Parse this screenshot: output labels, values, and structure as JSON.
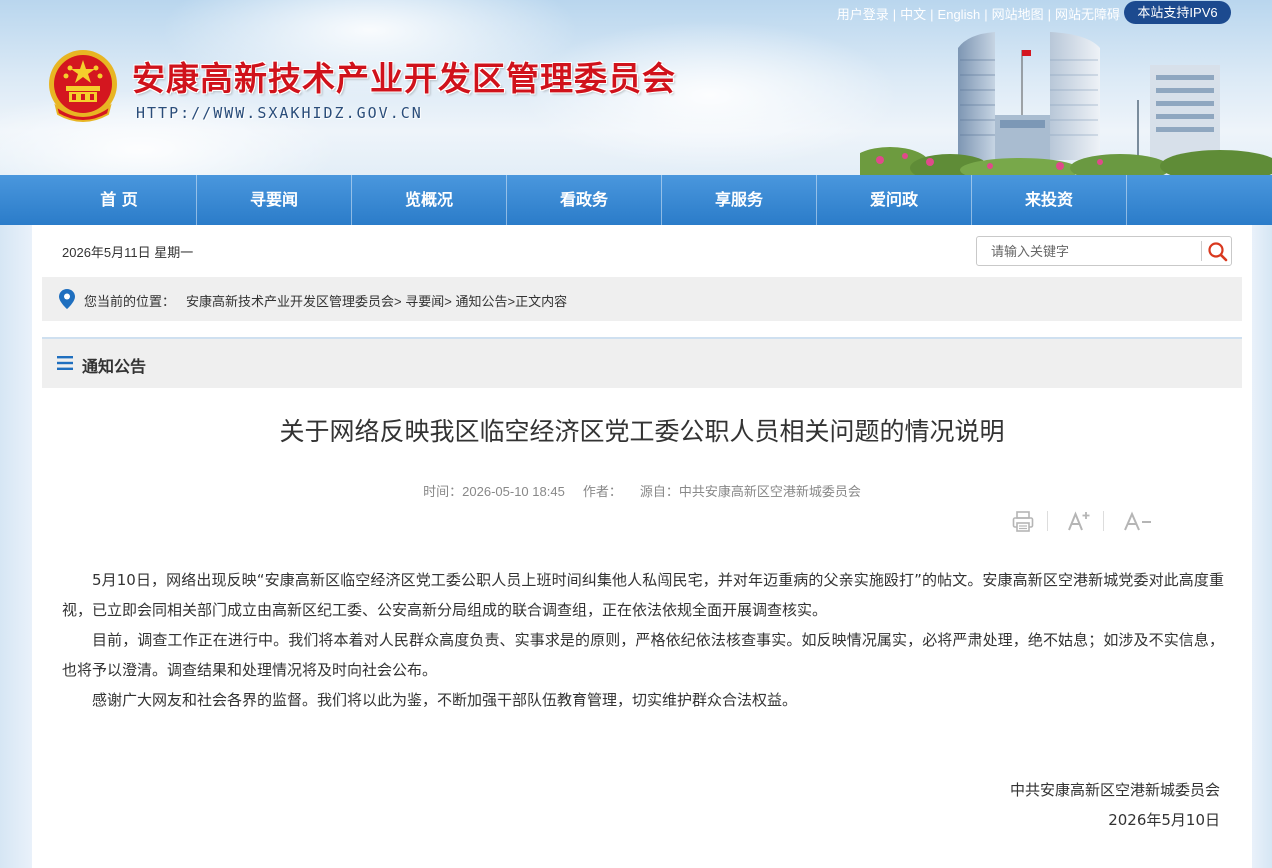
{
  "header": {
    "site_title": "安康高新技术产业开发区管理委员会",
    "site_url": "HTTP://WWW.SXAKHIDZ.GOV.CN",
    "top_links": [
      "用户登录",
      "中文",
      "English",
      "网站地图",
      "网站无障碍"
    ],
    "ipv6_badge": "本站支持IPV6"
  },
  "nav": {
    "items": [
      "首 页",
      "寻要闻",
      "览概况",
      "看政务",
      "享服务",
      "爱问政",
      "来投资"
    ]
  },
  "toolbar": {
    "date": "2026年5月11日 星期一",
    "search_placeholder": "请输入关键字"
  },
  "breadcrumb": {
    "label": "您当前的位置：",
    "items": [
      "安康高新技术产业开发区管理委员会",
      "寻要闻",
      "通知公告",
      "正文内容"
    ]
  },
  "section": {
    "title": "通知公告"
  },
  "article": {
    "title": "关于网络反映我区临空经济区党工委公职人员相关问题的情况说明",
    "time": "时间：2026-05-10 18:45",
    "author": "作者：",
    "source": "源自：中共安康高新区空港新城委员会",
    "paragraphs": [
      "5月10日，网络出现反映“安康高新区临空经济区党工委公职人员上班时间纠集他人私闯民宅，并对年迈重病的父亲实施殴打”的帖文。安康高新区空港新城党委对此高度重视，已立即会同相关部门成立由高新区纪工委、公安高新分局组成的联合调查组，正在依法依规全面开展调查核实。",
      "目前，调查工作正在进行中。我们将本着对人民群众高度负责、实事求是的原则，严格依纪依法核查事实。如反映情况属实，必将严肃处理，绝不姑息；如涉及不实信息，也将予以澄清。调查结果和处理情况将及时向社会公布。",
      "感谢广大网友和社会各界的监督。我们将以此为鉴，不断加强干部队伍教育管理，切实维护群众合法权益。"
    ],
    "signature_org": "中共安康高新区空港新城委员会",
    "signature_date": "2026年5月10日"
  },
  "colors": {
    "title_red": "#d0121b",
    "nav_blue": "#2b7cc9",
    "ipv6_blue": "#1c4a8f",
    "icon_blue": "#1f6fbf",
    "search_red": "#d9381e"
  },
  "icons": {
    "emblem": "national-emblem-icon",
    "location": "location-pin-icon",
    "menu": "menu-lines-icon",
    "search": "search-icon",
    "print": "print-icon",
    "font_up": "font-increase-icon",
    "font_down": "font-decrease-icon"
  }
}
